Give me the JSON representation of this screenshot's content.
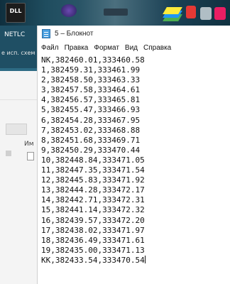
{
  "desktop": {
    "dll_icon_label": "DLL",
    "netlc_label": "NETLC",
    "explorer_subtitle": "е исп. схем",
    "explorer_partial_label": "Им"
  },
  "notepad": {
    "title": "5 – Блокнот",
    "menu": [
      "Файл",
      "Правка",
      "Формат",
      "Вид",
      "Справка"
    ],
    "lines": [
      "NK,382460.01,333460.58",
      "1,382459.31,333461.99",
      "2,382458.50,333463.33",
      "3,382457.58,333464.61",
      "4,382456.57,333465.81",
      "5,382455.47,333466.93",
      "6,382454.28,333467.95",
      "7,382453.02,333468.88",
      "8,382451.68,333469.71",
      "9,382450.29,333470.44",
      "10,382448.84,333471.05",
      "11,382447.35,333471.54",
      "12,382445.83,333471.92",
      "13,382444.28,333472.17",
      "14,382442.71,333472.31",
      "15,382441.14,333472.32",
      "16,382439.57,333472.20",
      "17,382438.02,333471.97",
      "18,382436.49,333471.61",
      "19,382435.00,333471.13",
      "KK,382433.54,333470.54"
    ]
  },
  "colors": {
    "desktop_dark": "#0f2f3e",
    "notepad_icon": "#4aa0e0"
  }
}
